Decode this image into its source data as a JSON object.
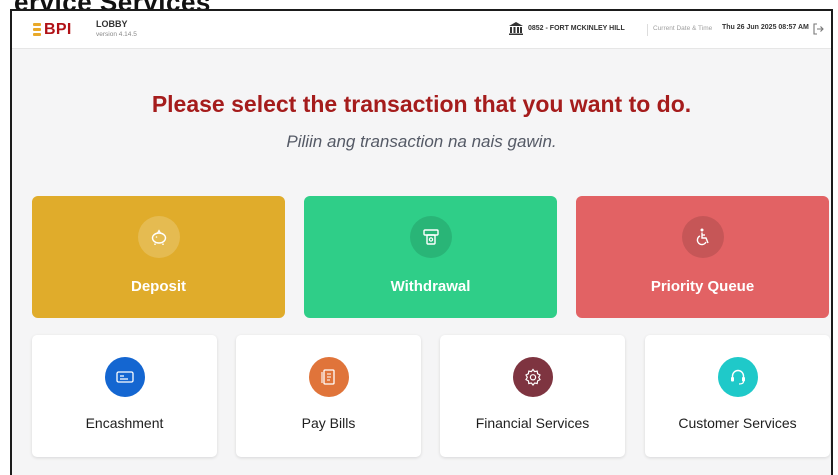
{
  "page_heading_cropped": "ervice Services",
  "topbar": {
    "logo_text": "BPI",
    "module_name": "LOBBY",
    "version": "version 4.14.5",
    "branch": "0852 - FORT MCKINLEY HILL",
    "datetime_label": "Current Date & Time",
    "datetime_value": "Thu 26 Jun 2025 08:57 AM"
  },
  "main": {
    "heading": "Please select the transaction that you want to do.",
    "subheading": "Piliin ang transaction na nais gawin."
  },
  "primary_tiles": [
    {
      "label": "Deposit",
      "icon": "piggy-bank-icon",
      "color": "#e0ac2b"
    },
    {
      "label": "Withdrawal",
      "icon": "cash-withdrawal-icon",
      "color": "#2fce88"
    },
    {
      "label": "Priority Queue",
      "icon": "wheelchair-icon",
      "color": "#e26264"
    }
  ],
  "secondary_tiles": [
    {
      "label": "Encashment",
      "icon": "check-icon",
      "color": "#1466d1"
    },
    {
      "label": "Pay Bills",
      "icon": "bill-icon",
      "color": "#e0743a"
    },
    {
      "label": "Financial Services",
      "icon": "gear-icon",
      "color": "#7e3440"
    },
    {
      "label": "Customer Services",
      "icon": "headset-icon",
      "color": "#1fc9c9"
    }
  ],
  "colors": {
    "brand_red": "#b11116",
    "heading_red": "#a51c1c",
    "background": "#f5f5f6"
  }
}
